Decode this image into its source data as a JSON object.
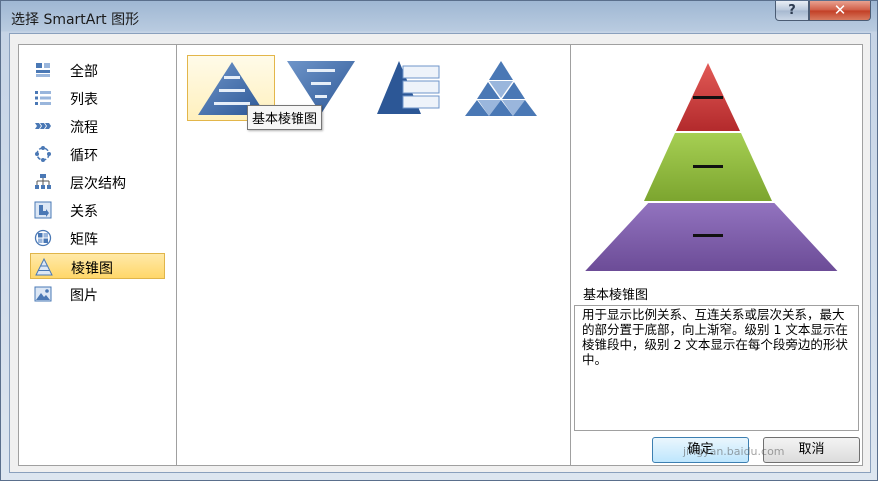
{
  "window": {
    "title": "选择 SmartArt 图形",
    "help_label": "?",
    "close_label": "✕"
  },
  "categories": [
    {
      "label": "全部",
      "icon": "all-icon"
    },
    {
      "label": "列表",
      "icon": "list-icon"
    },
    {
      "label": "流程",
      "icon": "process-icon"
    },
    {
      "label": "循环",
      "icon": "cycle-icon"
    },
    {
      "label": "层次结构",
      "icon": "hierarchy-icon"
    },
    {
      "label": "关系",
      "icon": "relationship-icon"
    },
    {
      "label": "矩阵",
      "icon": "matrix-icon"
    },
    {
      "label": "棱锥图",
      "icon": "pyramid-icon",
      "selected": true
    },
    {
      "label": "图片",
      "icon": "picture-icon"
    }
  ],
  "layouts": {
    "selected_index": 0,
    "tooltip": "基本棱锥图"
  },
  "preview": {
    "name": "基本棱锥图",
    "description": "用于显示比例关系、互连关系或层次关系，最大的部分置于底部，向上渐窄。级别 1 文本显示在棱锥段中，级别 2 文本显示在每个段旁边的形状中。",
    "colors": {
      "top": "#c0393b",
      "middle": "#8cb83c",
      "bottom": "#7c59a3"
    }
  },
  "buttons": {
    "ok": "确定",
    "cancel": "取消"
  },
  "watermark": {
    "logo": "Baidu 经验",
    "url": "jingyan.baidu.com"
  }
}
